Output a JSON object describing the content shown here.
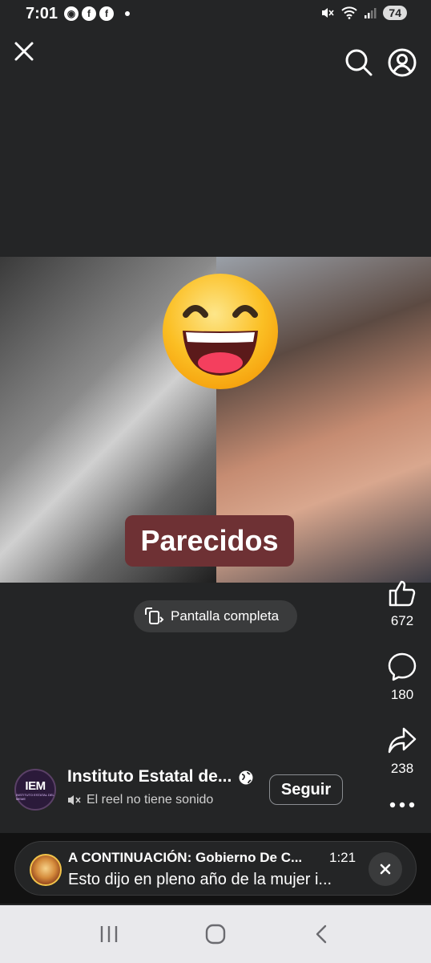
{
  "status": {
    "time": "7:01",
    "battery": "74",
    "notif_icons": [
      "eye-icon",
      "facebook-icon",
      "facebook-icon"
    ]
  },
  "top_bar": {
    "close_icon": "close-icon",
    "search_icon": "search-icon",
    "profile_icon": "profile-icon"
  },
  "video": {
    "caption": "Parecidos",
    "emoji": "grinning-face-emoji"
  },
  "fullscreen": {
    "label": "Pantalla completa"
  },
  "actions": {
    "likes": "672",
    "comments": "180",
    "shares": "238"
  },
  "author": {
    "avatar_text": "IEM",
    "avatar_subtext": "INSTITUTO ESTATAL DEL MEME",
    "name": "Instituto Estatal de...",
    "audio_text": "El reel no tiene sonido",
    "follow_label": "Seguir"
  },
  "next_up": {
    "title": "A CONTINUACIÓN: Gobierno De C...",
    "duration": "1:21",
    "subtitle": "Esto dijo en pleno año de la mujer i..."
  },
  "colors": {
    "background": "#242526",
    "caption_bg": "#6e3134",
    "emoji_yellow": "#fbbf24"
  }
}
